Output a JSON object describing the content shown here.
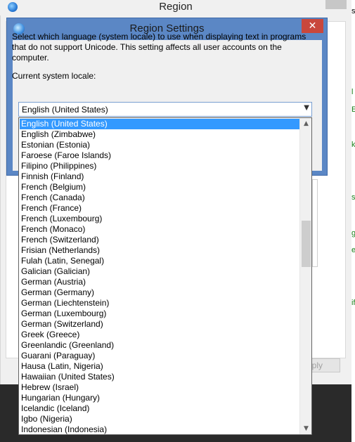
{
  "background_window": {
    "title": "Region",
    "apply_label": "pply",
    "right_edge_texts": [
      "s",
      "l",
      "E",
      "k",
      "s",
      "g",
      "e",
      "if"
    ]
  },
  "dialog": {
    "title": "Region Settings",
    "close_glyph": "✕",
    "description": "Select which language (system locale) to use when displaying text in programs that do not support Unicode. This setting affects all user accounts on the computer.",
    "current_locale_label": "Current system locale:",
    "current_locale_value": "English (United States)"
  },
  "locale_list": {
    "selected_index": 0,
    "items": [
      "English (United States)",
      "English (Zimbabwe)",
      "Estonian (Estonia)",
      "Faroese (Faroe Islands)",
      "Filipino (Philippines)",
      "Finnish (Finland)",
      "French (Belgium)",
      "French (Canada)",
      "French (France)",
      "French (Luxembourg)",
      "French (Monaco)",
      "French (Switzerland)",
      "Frisian (Netherlands)",
      "Fulah (Latin, Senegal)",
      "Galician (Galician)",
      "German (Austria)",
      "German (Germany)",
      "German (Liechtenstein)",
      "German (Luxembourg)",
      "German (Switzerland)",
      "Greek (Greece)",
      "Greenlandic (Greenland)",
      "Guarani (Paraguay)",
      "Hausa (Latin, Nigeria)",
      "Hawaiian (United States)",
      "Hebrew (Israel)",
      "Hungarian (Hungary)",
      "Icelandic (Iceland)",
      "Igbo (Nigeria)",
      "Indonesian (Indonesia)"
    ]
  },
  "colors": {
    "selection": "#3399ff",
    "dialog_frame": "#5b87c5",
    "close_button": "#c9473c",
    "right_edge_text": "#1a7f1a"
  }
}
